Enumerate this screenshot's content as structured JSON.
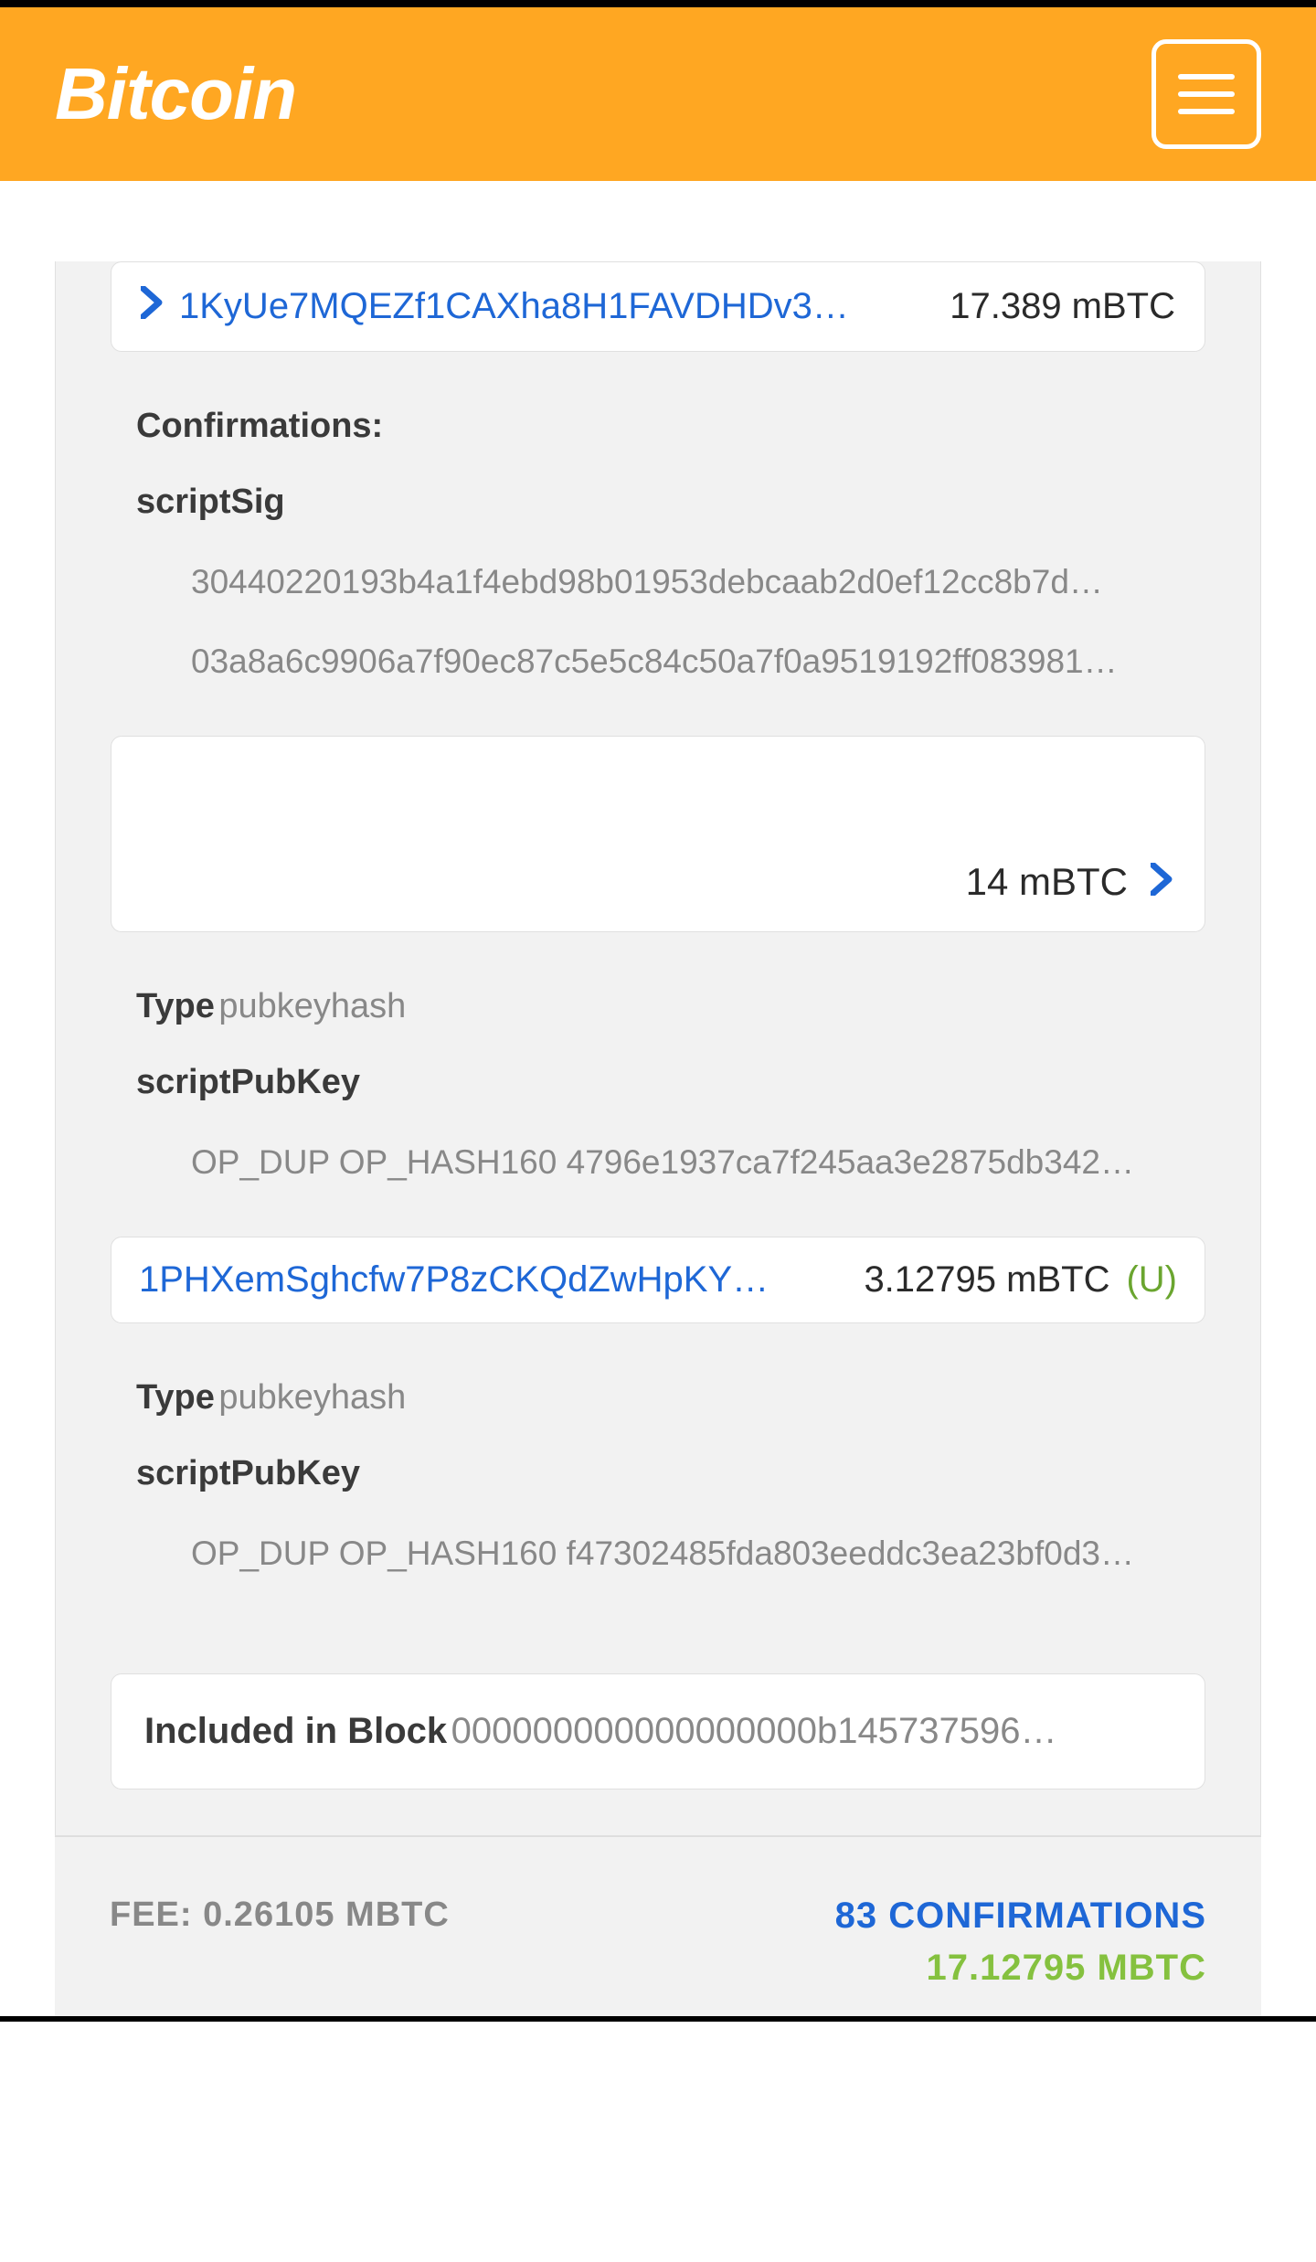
{
  "nav": {
    "brand": "Bitcoin"
  },
  "input": {
    "address": "1KyUe7MQEZf1CAXha8H1FAVDHDv3…",
    "amount": "17.389 mBTC",
    "confirmations_label": "Confirmations:",
    "scriptSig_label": "scriptSig",
    "scriptSig_lines": [
      "30440220193b4a1f4ebd98b01953debcaab2d0ef12cc8b7d…",
      "03a8a6c9906a7f90ec87c5e5c84c50a7f0a9519192ff083981…"
    ]
  },
  "outputs": [
    {
      "amount": "14 mBTC",
      "type_label": "Type",
      "type_value": "pubkeyhash",
      "scriptPubKey_label": "scriptPubKey",
      "scriptPubKey_line": "OP_DUP OP_HASH160 4796e1937ca7f245aa3e2875db342…"
    },
    {
      "address": "1PHXemSghcfw7P8zCKQdZwHpKY…",
      "amount": "3.12795 mBTC",
      "unspent_flag": "(U)",
      "type_label": "Type",
      "type_value": "pubkeyhash",
      "scriptPubKey_label": "scriptPubKey",
      "scriptPubKey_line": "OP_DUP OP_HASH160 f47302485fda803eeddc3ea23bf0d3…"
    }
  ],
  "block": {
    "label": "Included in Block",
    "hash": "000000000000000000b145737596…"
  },
  "footer": {
    "fee": "FEE: 0.26105 MBTC",
    "confirmations": "83 CONFIRMATIONS",
    "total": "17.12795 MBTC"
  }
}
